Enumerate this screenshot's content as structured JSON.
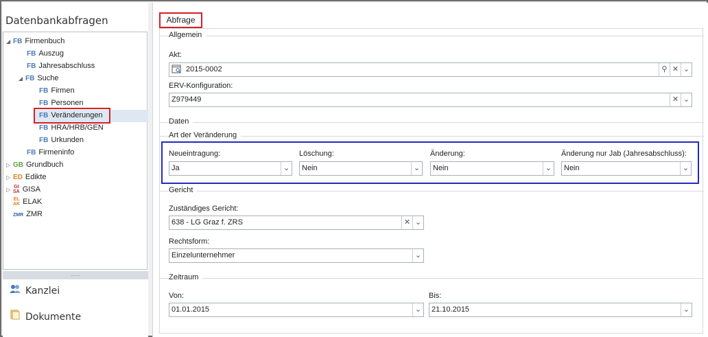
{
  "sidebar": {
    "title": "Datenbankabfragen",
    "tree": [
      {
        "tag": "FB",
        "label": "Firmenbuch"
      },
      {
        "tag": "FB",
        "label": "Auszug"
      },
      {
        "tag": "FB",
        "label": "Jahresabschluss"
      },
      {
        "tag": "FB",
        "label": "Suche"
      },
      {
        "tag": "FB",
        "label": "Firmen"
      },
      {
        "tag": "FB",
        "label": "Personen"
      },
      {
        "tag": "FB",
        "label": "Veränderungen"
      },
      {
        "tag": "FB",
        "label": "HRA/HRB/GEN"
      },
      {
        "tag": "FB",
        "label": "Urkunden"
      },
      {
        "tag": "FB",
        "label": "Firmeninfo"
      },
      {
        "tag": "GB",
        "label": "Grundbuch"
      },
      {
        "tag": "ED",
        "label": "Edikte"
      },
      {
        "tag_top": "GI",
        "tag_bottom": "SA",
        "label": "GISA"
      },
      {
        "tag_top": "EL",
        "tag_bottom": "AK",
        "label": "ELAK"
      },
      {
        "tag": "ZMR",
        "label": "ZMR"
      }
    ],
    "splitter_grip": "......",
    "nav": [
      {
        "label": "Kanzlei",
        "icon": "people-icon"
      },
      {
        "label": "Dokumente",
        "icon": "documents-icon"
      }
    ]
  },
  "main": {
    "tab_label": "Abfrage",
    "allgemein": {
      "title": "Allgemein",
      "akt_label": "Akt:",
      "akt_value": "2015-0002",
      "erv_label": "ERV-Konfiguration:",
      "erv_value": "Z979449"
    },
    "daten": {
      "title": "Daten",
      "art_title": "Art der Veränderung",
      "fields": [
        {
          "label": "Neueintragung:",
          "value": "Ja"
        },
        {
          "label": "Löschung:",
          "value": "Nein"
        },
        {
          "label": "Änderung:",
          "value": "Nein"
        },
        {
          "label": "Änderung nur Jab (Jahresabschluss):",
          "value": "Nein"
        }
      ]
    },
    "gericht": {
      "title": "Gericht",
      "court_label": "Zuständiges Gericht:",
      "court_value": "638 - LG Graz f. ZRS",
      "form_label": "Rechtsform:",
      "form_value": "Einzelunternehmer"
    },
    "zeitraum": {
      "title": "Zeitraum",
      "von_label": "Von:",
      "von_value": "01.01.2015",
      "bis_label": "Bis:",
      "bis_value": "21.10.2015"
    },
    "glyphs": {
      "search": "⚲",
      "clear": "✕",
      "dropdown": "⌄"
    }
  }
}
